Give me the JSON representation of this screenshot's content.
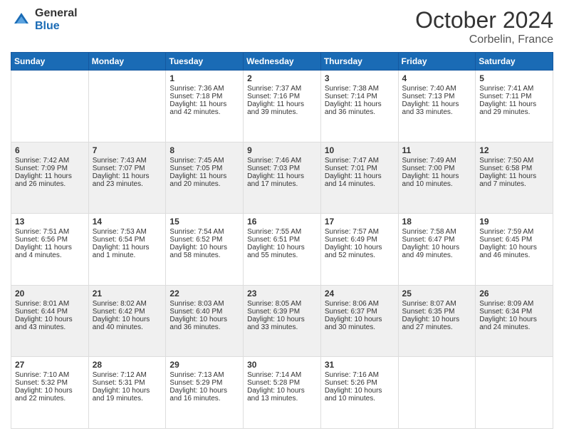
{
  "header": {
    "logo_general": "General",
    "logo_blue": "Blue",
    "month": "October 2024",
    "location": "Corbelin, France"
  },
  "days_of_week": [
    "Sunday",
    "Monday",
    "Tuesday",
    "Wednesday",
    "Thursday",
    "Friday",
    "Saturday"
  ],
  "weeks": [
    [
      {
        "day": "",
        "sunrise": "",
        "sunset": "",
        "daylight": ""
      },
      {
        "day": "",
        "sunrise": "",
        "sunset": "",
        "daylight": ""
      },
      {
        "day": "1",
        "sunrise": "Sunrise: 7:36 AM",
        "sunset": "Sunset: 7:18 PM",
        "daylight": "Daylight: 11 hours and 42 minutes."
      },
      {
        "day": "2",
        "sunrise": "Sunrise: 7:37 AM",
        "sunset": "Sunset: 7:16 PM",
        "daylight": "Daylight: 11 hours and 39 minutes."
      },
      {
        "day": "3",
        "sunrise": "Sunrise: 7:38 AM",
        "sunset": "Sunset: 7:14 PM",
        "daylight": "Daylight: 11 hours and 36 minutes."
      },
      {
        "day": "4",
        "sunrise": "Sunrise: 7:40 AM",
        "sunset": "Sunset: 7:13 PM",
        "daylight": "Daylight: 11 hours and 33 minutes."
      },
      {
        "day": "5",
        "sunrise": "Sunrise: 7:41 AM",
        "sunset": "Sunset: 7:11 PM",
        "daylight": "Daylight: 11 hours and 29 minutes."
      }
    ],
    [
      {
        "day": "6",
        "sunrise": "Sunrise: 7:42 AM",
        "sunset": "Sunset: 7:09 PM",
        "daylight": "Daylight: 11 hours and 26 minutes."
      },
      {
        "day": "7",
        "sunrise": "Sunrise: 7:43 AM",
        "sunset": "Sunset: 7:07 PM",
        "daylight": "Daylight: 11 hours and 23 minutes."
      },
      {
        "day": "8",
        "sunrise": "Sunrise: 7:45 AM",
        "sunset": "Sunset: 7:05 PM",
        "daylight": "Daylight: 11 hours and 20 minutes."
      },
      {
        "day": "9",
        "sunrise": "Sunrise: 7:46 AM",
        "sunset": "Sunset: 7:03 PM",
        "daylight": "Daylight: 11 hours and 17 minutes."
      },
      {
        "day": "10",
        "sunrise": "Sunrise: 7:47 AM",
        "sunset": "Sunset: 7:01 PM",
        "daylight": "Daylight: 11 hours and 14 minutes."
      },
      {
        "day": "11",
        "sunrise": "Sunrise: 7:49 AM",
        "sunset": "Sunset: 7:00 PM",
        "daylight": "Daylight: 11 hours and 10 minutes."
      },
      {
        "day": "12",
        "sunrise": "Sunrise: 7:50 AM",
        "sunset": "Sunset: 6:58 PM",
        "daylight": "Daylight: 11 hours and 7 minutes."
      }
    ],
    [
      {
        "day": "13",
        "sunrise": "Sunrise: 7:51 AM",
        "sunset": "Sunset: 6:56 PM",
        "daylight": "Daylight: 11 hours and 4 minutes."
      },
      {
        "day": "14",
        "sunrise": "Sunrise: 7:53 AM",
        "sunset": "Sunset: 6:54 PM",
        "daylight": "Daylight: 11 hours and 1 minute."
      },
      {
        "day": "15",
        "sunrise": "Sunrise: 7:54 AM",
        "sunset": "Sunset: 6:52 PM",
        "daylight": "Daylight: 10 hours and 58 minutes."
      },
      {
        "day": "16",
        "sunrise": "Sunrise: 7:55 AM",
        "sunset": "Sunset: 6:51 PM",
        "daylight": "Daylight: 10 hours and 55 minutes."
      },
      {
        "day": "17",
        "sunrise": "Sunrise: 7:57 AM",
        "sunset": "Sunset: 6:49 PM",
        "daylight": "Daylight: 10 hours and 52 minutes."
      },
      {
        "day": "18",
        "sunrise": "Sunrise: 7:58 AM",
        "sunset": "Sunset: 6:47 PM",
        "daylight": "Daylight: 10 hours and 49 minutes."
      },
      {
        "day": "19",
        "sunrise": "Sunrise: 7:59 AM",
        "sunset": "Sunset: 6:45 PM",
        "daylight": "Daylight: 10 hours and 46 minutes."
      }
    ],
    [
      {
        "day": "20",
        "sunrise": "Sunrise: 8:01 AM",
        "sunset": "Sunset: 6:44 PM",
        "daylight": "Daylight: 10 hours and 43 minutes."
      },
      {
        "day": "21",
        "sunrise": "Sunrise: 8:02 AM",
        "sunset": "Sunset: 6:42 PM",
        "daylight": "Daylight: 10 hours and 40 minutes."
      },
      {
        "day": "22",
        "sunrise": "Sunrise: 8:03 AM",
        "sunset": "Sunset: 6:40 PM",
        "daylight": "Daylight: 10 hours and 36 minutes."
      },
      {
        "day": "23",
        "sunrise": "Sunrise: 8:05 AM",
        "sunset": "Sunset: 6:39 PM",
        "daylight": "Daylight: 10 hours and 33 minutes."
      },
      {
        "day": "24",
        "sunrise": "Sunrise: 8:06 AM",
        "sunset": "Sunset: 6:37 PM",
        "daylight": "Daylight: 10 hours and 30 minutes."
      },
      {
        "day": "25",
        "sunrise": "Sunrise: 8:07 AM",
        "sunset": "Sunset: 6:35 PM",
        "daylight": "Daylight: 10 hours and 27 minutes."
      },
      {
        "day": "26",
        "sunrise": "Sunrise: 8:09 AM",
        "sunset": "Sunset: 6:34 PM",
        "daylight": "Daylight: 10 hours and 24 minutes."
      }
    ],
    [
      {
        "day": "27",
        "sunrise": "Sunrise: 7:10 AM",
        "sunset": "Sunset: 5:32 PM",
        "daylight": "Daylight: 10 hours and 22 minutes."
      },
      {
        "day": "28",
        "sunrise": "Sunrise: 7:12 AM",
        "sunset": "Sunset: 5:31 PM",
        "daylight": "Daylight: 10 hours and 19 minutes."
      },
      {
        "day": "29",
        "sunrise": "Sunrise: 7:13 AM",
        "sunset": "Sunset: 5:29 PM",
        "daylight": "Daylight: 10 hours and 16 minutes."
      },
      {
        "day": "30",
        "sunrise": "Sunrise: 7:14 AM",
        "sunset": "Sunset: 5:28 PM",
        "daylight": "Daylight: 10 hours and 13 minutes."
      },
      {
        "day": "31",
        "sunrise": "Sunrise: 7:16 AM",
        "sunset": "Sunset: 5:26 PM",
        "daylight": "Daylight: 10 hours and 10 minutes."
      },
      {
        "day": "",
        "sunrise": "",
        "sunset": "",
        "daylight": ""
      },
      {
        "day": "",
        "sunrise": "",
        "sunset": "",
        "daylight": ""
      }
    ]
  ]
}
